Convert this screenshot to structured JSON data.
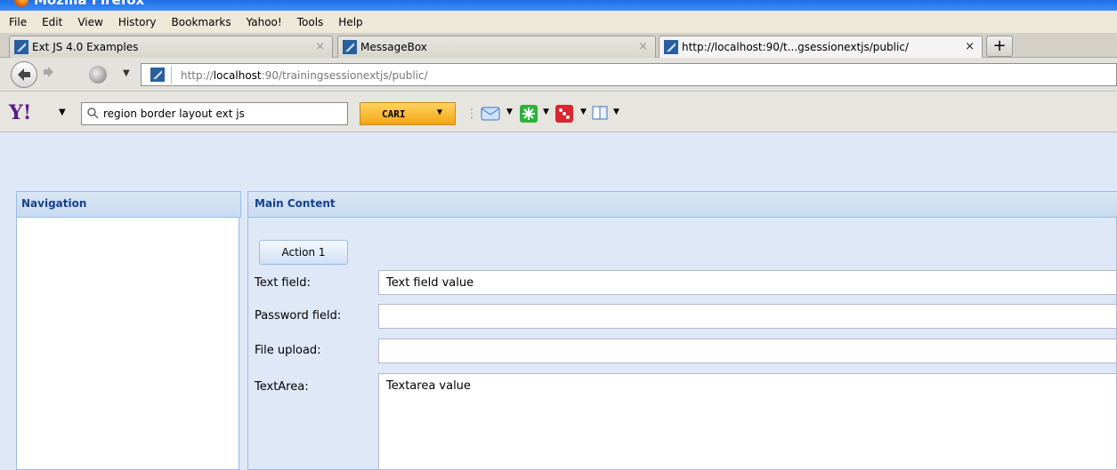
{
  "window": {
    "title": "Mozilla Firefox"
  },
  "menubar": {
    "items": [
      {
        "label": "File"
      },
      {
        "label": "Edit"
      },
      {
        "label": "View"
      },
      {
        "label": "History"
      },
      {
        "label": "Bookmarks"
      },
      {
        "label": "Yahoo!"
      },
      {
        "label": "Tools"
      },
      {
        "label": "Help"
      }
    ]
  },
  "tabs": [
    {
      "label": "Ext JS 4.0 Examples",
      "close": "×"
    },
    {
      "label": "MessageBox",
      "close": "×"
    },
    {
      "label": "http://localhost:90/t...gsessionextjs/public/",
      "close": "×"
    }
  ],
  "newtab": {
    "label": "+"
  },
  "navbar": {
    "url_prefix": "http://",
    "url_host": "localhost",
    "url_rest": ":90/trainingsessionextjs/public/"
  },
  "yahoo": {
    "logo": "Y!",
    "search_value": "region border layout ext js",
    "search_button": "CARI",
    "dropdown_glyph": "▼"
  },
  "app": {
    "nav_title": "Navigation",
    "main_title": "Main Content",
    "action_button": "Action 1",
    "fields": [
      {
        "label": "Text field:",
        "value": "Text field value"
      },
      {
        "label": "Password field:",
        "value": ""
      },
      {
        "label": "File upload:",
        "value": ""
      },
      {
        "label": "TextArea:",
        "value": "Textarea value"
      }
    ]
  },
  "colors": {
    "panel_header_text": "#15428b",
    "panel_border": "#99bbe8",
    "app_bg": "#dfe8f6"
  }
}
